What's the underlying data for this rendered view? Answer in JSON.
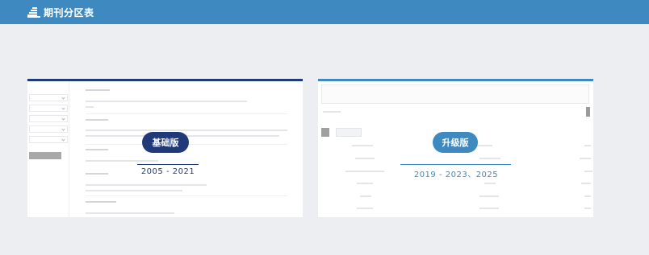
{
  "header": {
    "title": "期刊分区表",
    "background": "#3e89c0",
    "icon": "stacked-bars-icon"
  },
  "cards": {
    "basic": {
      "label": "基础版",
      "years": "2005 - 2021",
      "accent": "#203a79"
    },
    "pro": {
      "label": "升级版",
      "years": "2019 - 2023、2025",
      "accent": "#3e89c0"
    }
  }
}
